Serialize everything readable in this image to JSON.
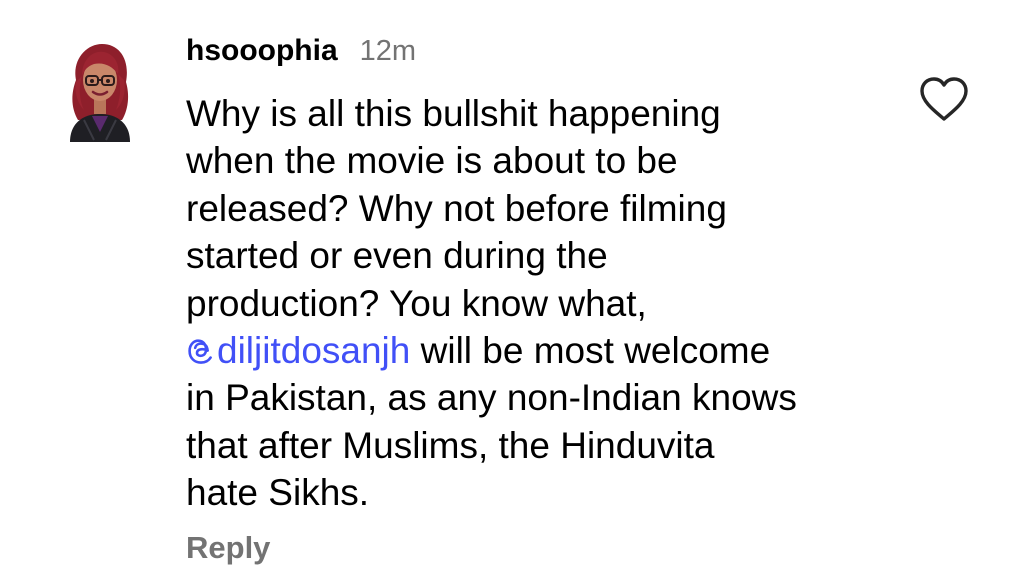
{
  "comment": {
    "username": "hsooophia",
    "timestamp": "12m",
    "avatar_icon": "bitmoji-avatar-icon",
    "lines": [
      "Why is all this bullshit happening",
      "when the movie is about to be",
      "released? Why not before filming",
      "started or even during the",
      "production? You know what,"
    ],
    "mention": {
      "icon": "threads-icon",
      "handle": "diljitdosanjh",
      "after": " will be most welcome"
    },
    "lines_after": [
      "in Pakistan, as any non-Indian knows",
      "that after Muslims, the Hinduvita",
      "hate Sikhs."
    ],
    "like_icon": "heart-outline-icon",
    "reply_label": "Reply"
  },
  "colors": {
    "text": "#000000",
    "secondary": "#737373",
    "mention": "#4150f7"
  }
}
